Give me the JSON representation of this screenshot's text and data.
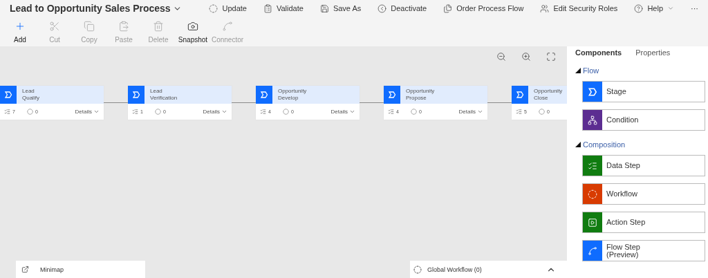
{
  "title": "Lead to Opportunity Sales Process",
  "command_bar": [
    {
      "kind": "update",
      "label": "Update"
    },
    {
      "kind": "validate",
      "label": "Validate"
    },
    {
      "kind": "save_as",
      "label": "Save As"
    },
    {
      "kind": "deactivate",
      "label": "Deactivate"
    },
    {
      "kind": "order",
      "label": "Order Process Flow"
    },
    {
      "kind": "security",
      "label": "Edit Security Roles"
    },
    {
      "kind": "help",
      "label": "Help"
    },
    {
      "kind": "more",
      "label": "···"
    }
  ],
  "toolbar": [
    {
      "kind": "add",
      "label": "Add",
      "disabled": false
    },
    {
      "kind": "cut",
      "label": "Cut",
      "disabled": true
    },
    {
      "kind": "copy",
      "label": "Copy",
      "disabled": true
    },
    {
      "kind": "paste",
      "label": "Paste",
      "disabled": true
    },
    {
      "kind": "delete",
      "label": "Delete",
      "disabled": true
    },
    {
      "kind": "snapshot",
      "label": "Snapshot",
      "disabled": false
    },
    {
      "kind": "connector",
      "label": "Connector",
      "disabled": true
    }
  ],
  "stages": [
    {
      "entity": "Lead",
      "name": "Qualify",
      "steps": "7",
      "workflows": "0",
      "details": "Details"
    },
    {
      "entity": "Lead",
      "name": "Verification",
      "steps": "1",
      "workflows": "0",
      "details": "Details"
    },
    {
      "entity": "Opportunity",
      "name": "Develop",
      "steps": "4",
      "workflows": "0",
      "details": "Details"
    },
    {
      "entity": "Opportunity",
      "name": "Propose",
      "steps": "4",
      "workflows": "0",
      "details": "Details"
    },
    {
      "entity": "Opportunity",
      "name": "Close",
      "steps": "5",
      "workflows": "0"
    }
  ],
  "minimap": {
    "label": "Minimap"
  },
  "global_workflow": {
    "label": "Global Workflow (0)"
  },
  "panel": {
    "tabs": [
      {
        "label": "Components",
        "selected": true
      },
      {
        "label": "Properties",
        "selected": false
      }
    ],
    "groups": [
      {
        "label": "Flow",
        "expanded": true,
        "items": [
          {
            "kind": "stage",
            "label": "Stage",
            "color": "#0f6cff"
          },
          {
            "kind": "condition",
            "label": "Condition",
            "color": "#5c2d91"
          }
        ]
      },
      {
        "label": "Composition",
        "expanded": true,
        "items": [
          {
            "kind": "data_step",
            "label": "Data Step",
            "color": "#107c10"
          },
          {
            "kind": "workflow",
            "label": "Workflow",
            "color": "#d83b01"
          },
          {
            "kind": "action_step",
            "label": "Action Step",
            "color": "#107c10"
          },
          {
            "kind": "flow_step",
            "label": "Flow Step (Preview)",
            "color": "#0f6cff"
          }
        ]
      }
    ]
  }
}
